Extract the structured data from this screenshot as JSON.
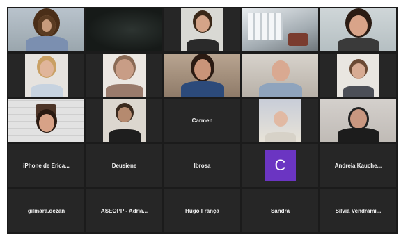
{
  "participants": [
    {
      "name": "",
      "type": "video"
    },
    {
      "name": "",
      "type": "video"
    },
    {
      "name": "",
      "type": "video"
    },
    {
      "name": "",
      "type": "video"
    },
    {
      "name": "",
      "type": "video",
      "active_speaker": true
    },
    {
      "name": "",
      "type": "video"
    },
    {
      "name": "",
      "type": "video"
    },
    {
      "name": "",
      "type": "video"
    },
    {
      "name": "",
      "type": "video"
    },
    {
      "name": "",
      "type": "video"
    },
    {
      "name": "",
      "type": "video"
    },
    {
      "name": "",
      "type": "video"
    },
    {
      "name": "Carmen",
      "type": "name"
    },
    {
      "name": "",
      "type": "video"
    },
    {
      "name": "",
      "type": "video"
    },
    {
      "name": "iPhone de Erica...",
      "type": "name"
    },
    {
      "name": "Deusiene",
      "type": "name"
    },
    {
      "name": "Ibrosa",
      "type": "name"
    },
    {
      "name": "",
      "type": "avatar",
      "initial": "C",
      "avatar_color": "#6b35c2"
    },
    {
      "name": "Andreia  Kauche...",
      "type": "name"
    },
    {
      "name": "gilmara.dezan",
      "type": "name"
    },
    {
      "name": "ASEOPP - Adria...",
      "type": "name"
    },
    {
      "name": "Hugo França",
      "type": "name"
    },
    {
      "name": "Sandra",
      "type": "name"
    },
    {
      "name": "Silvia  Vendrami...",
      "type": "name"
    }
  ],
  "colors": {
    "background": "#1b1b1b",
    "tile": "#262626",
    "active_border": "#c9c98a"
  }
}
